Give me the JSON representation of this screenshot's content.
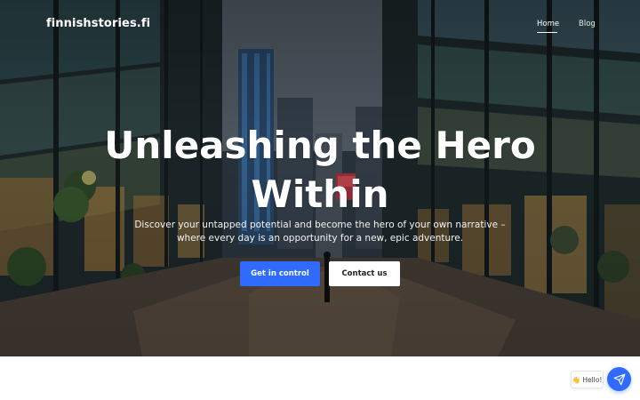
{
  "navbar": {
    "brand": "finnishstories.fi",
    "links": [
      {
        "label": "Home",
        "active": true
      },
      {
        "label": "Blog",
        "active": false
      }
    ]
  },
  "hero": {
    "title": "Unleashing the Hero Within",
    "subtitle": "Discover your untapped potential and become the hero of your own narrative – where every day is an opportunity for a new, epic adventure.",
    "primary_button": "Get in control",
    "secondary_button": "Contact us"
  },
  "chat": {
    "bubble_text": "👋 Hello!",
    "fab_icon": "send-icon"
  },
  "colors": {
    "accent": "#2f6bff",
    "nav_text": "#ffffff",
    "page_bg": "#ffffff"
  }
}
